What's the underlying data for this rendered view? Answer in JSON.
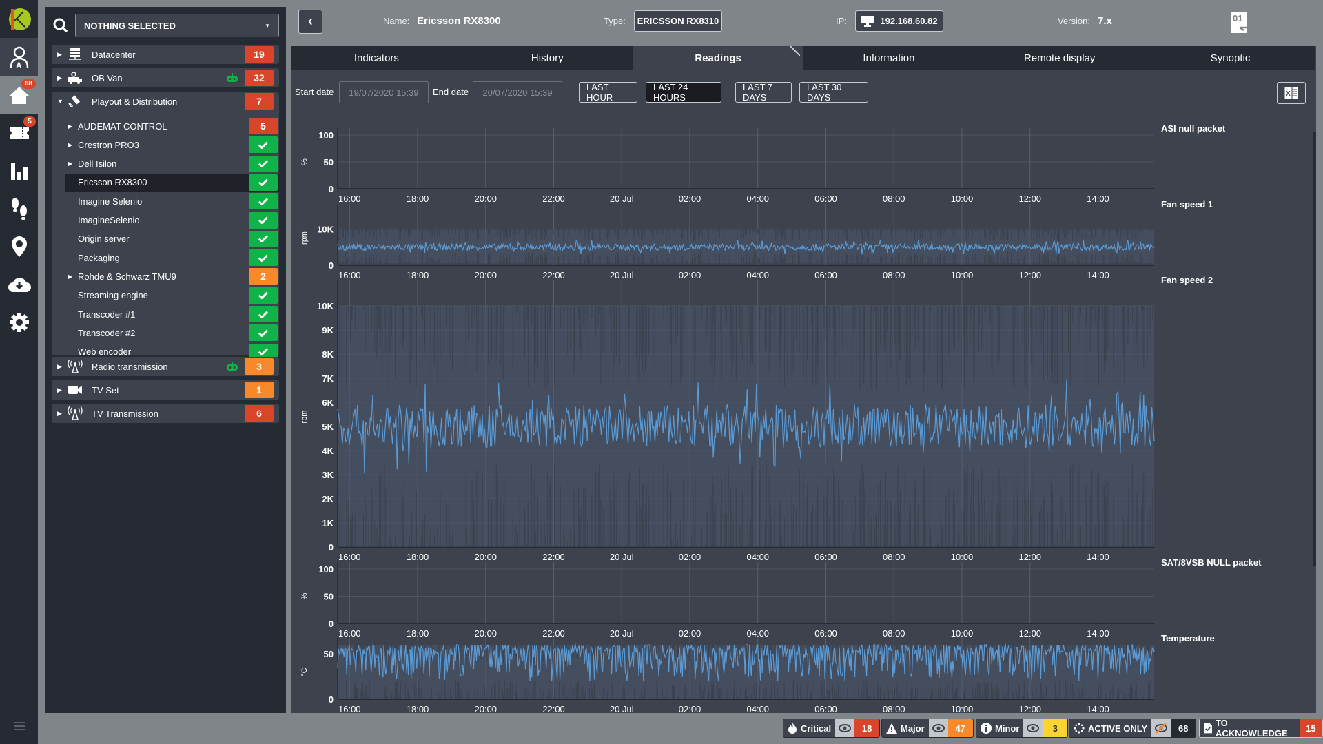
{
  "rail": {
    "items": [
      {
        "icon": "logo-icon"
      },
      {
        "icon": "user-admin-icon"
      },
      {
        "icon": "home-icon",
        "badge": "68"
      },
      {
        "icon": "ticket-icon",
        "badge": "5"
      },
      {
        "icon": "bar-chart-icon"
      },
      {
        "icon": "footsteps-icon"
      },
      {
        "icon": "map-pin-icon"
      },
      {
        "icon": "cloud-download-icon"
      },
      {
        "icon": "gear-icon"
      },
      {
        "icon": "menu-icon"
      }
    ]
  },
  "tree": {
    "search_value": "NOTHING SELECTED",
    "groups": [
      {
        "label": "Datacenter",
        "icon": "server-icon",
        "count": "19",
        "status": "red",
        "robot": false
      },
      {
        "label": "OB Van",
        "icon": "ob-van-icon",
        "count": "32",
        "status": "red",
        "robot": true
      },
      {
        "label": "Playout & Distribution",
        "icon": "satellite-icon",
        "count": "7",
        "status": "red",
        "robot": false,
        "expanded": true
      },
      {
        "label": "Radio transmission",
        "icon": "antenna-icon",
        "count": "3",
        "status": "orange",
        "robot": true
      },
      {
        "label": "TV Set",
        "icon": "video-camera-icon",
        "count": "1",
        "status": "orange",
        "robot": false
      },
      {
        "label": "TV Transmission",
        "icon": "antenna-icon",
        "count": "6",
        "status": "red",
        "robot": false
      }
    ],
    "children": [
      {
        "label": "AUDEMAT CONTROL",
        "expandable": true,
        "count": "5",
        "status": "red"
      },
      {
        "label": "Crestron PRO3",
        "expandable": true,
        "status": "ok"
      },
      {
        "label": "Dell Isilon",
        "expandable": true,
        "status": "ok"
      },
      {
        "label": "Ericsson RX8300",
        "expandable": false,
        "status": "ok",
        "selected": true
      },
      {
        "label": "Imagine Selenio",
        "expandable": false,
        "status": "ok"
      },
      {
        "label": "ImagineSelenio",
        "expandable": false,
        "status": "ok"
      },
      {
        "label": "Origin server",
        "expandable": false,
        "status": "ok"
      },
      {
        "label": "Packaging",
        "expandable": false,
        "status": "ok"
      },
      {
        "label": "Rohde & Schwarz TMU9",
        "expandable": true,
        "count": "2",
        "status": "orange"
      },
      {
        "label": "Streaming engine",
        "expandable": false,
        "status": "ok"
      },
      {
        "label": "Transcoder #1",
        "expandable": false,
        "status": "ok"
      },
      {
        "label": "Transcoder #2",
        "expandable": false,
        "status": "ok"
      },
      {
        "label": "Web encoder",
        "expandable": false,
        "status": "ok"
      }
    ]
  },
  "header": {
    "name_label": "Name:",
    "name_value": "Ericsson RX8300",
    "type_label": "Type:",
    "type_value": "ERICSSON RX8310",
    "ip_label": "IP:",
    "ip_value": "192.168.60.82",
    "version_label": "Version:",
    "version_value": "7.x"
  },
  "tabs": [
    {
      "label": "Indicators"
    },
    {
      "label": "History"
    },
    {
      "label": "Readings",
      "active": true
    },
    {
      "label": "Information"
    },
    {
      "label": "Remote display"
    },
    {
      "label": "Synoptic"
    }
  ],
  "filters": {
    "start_label": "Start date",
    "start_value": "19/07/2020 15:39",
    "end_label": "End date",
    "end_value": "20/07/2020 15:39",
    "ranges": [
      {
        "label": "LAST HOUR"
      },
      {
        "label": "LAST 24 HOURS",
        "active": true
      },
      {
        "label": "LAST 7 DAYS"
      },
      {
        "label": "LAST 30 DAYS"
      }
    ]
  },
  "chart_data": [
    {
      "type": "line",
      "title": "ASI null packet",
      "ylabel": "%",
      "ylim": [
        0,
        100
      ],
      "yticks": [
        "0",
        "50",
        "100"
      ],
      "xticks": [
        "16:00",
        "18:00",
        "20:00",
        "22:00",
        "20 Jul",
        "02:00",
        "04:00",
        "06:00",
        "08:00",
        "10:00",
        "12:00",
        "14:00"
      ],
      "series": [],
      "grid": true
    },
    {
      "type": "area",
      "title": "Fan speed 1",
      "ylabel": "rpm",
      "ylim": [
        0,
        15000
      ],
      "yticks": [
        "0",
        "10K"
      ],
      "yvals": [
        0,
        10000
      ],
      "xticks": [
        "16:00",
        "18:00",
        "20:00",
        "22:00",
        "20 Jul",
        "02:00",
        "04:00",
        "06:00",
        "08:00",
        "10:00",
        "12:00",
        "14:00"
      ],
      "series": [
        {
          "name": "Fan speed 1",
          "mean": 5000,
          "spread": 900,
          "band": [
            500,
            9800
          ]
        }
      ],
      "grid": true
    },
    {
      "type": "area",
      "title": "Fan speed 2",
      "ylabel": "rpm",
      "ylim": [
        0,
        10800
      ],
      "yticks": [
        "0",
        "1K",
        "2K",
        "3K",
        "4K",
        "5K",
        "6K",
        "7K",
        "8K",
        "9K",
        "10K"
      ],
      "yvals": [
        0,
        1000,
        2000,
        3000,
        4000,
        5000,
        6000,
        7000,
        8000,
        9000,
        10000
      ],
      "xticks": [
        "16:00",
        "18:00",
        "20:00",
        "22:00",
        "20 Jul",
        "02:00",
        "04:00",
        "06:00",
        "08:00",
        "10:00",
        "12:00",
        "14:00"
      ],
      "series": [
        {
          "name": "Fan speed 2",
          "mean": 5000,
          "spread": 900,
          "band": [
            0,
            10000
          ]
        }
      ],
      "grid": true
    },
    {
      "type": "line",
      "title": "SAT/8VSB NULL packet",
      "ylabel": "%",
      "ylim": [
        0,
        100
      ],
      "yticks": [
        "0",
        "50",
        "100"
      ],
      "xticks": [
        "16:00",
        "18:00",
        "20:00",
        "22:00",
        "20 Jul",
        "02:00",
        "04:00",
        "06:00",
        "08:00",
        "10:00",
        "12:00",
        "14:00"
      ],
      "series": [],
      "grid": true
    },
    {
      "type": "area",
      "title": "Temperature",
      "ylabel": "°C",
      "ylim": [
        0,
        60
      ],
      "yticks": [
        "0",
        "50"
      ],
      "yvals": [
        0,
        50
      ],
      "xticks": [
        "16:00",
        "18:00",
        "20:00",
        "22:00",
        "20 Jul",
        "02:00",
        "04:00",
        "06:00",
        "08:00",
        "10:00",
        "12:00",
        "14:00"
      ],
      "series": [
        {
          "name": "Temperature",
          "mean": 48,
          "spread": 10,
          "band": [
            0,
            60
          ]
        }
      ],
      "grid": true
    }
  ],
  "footer": {
    "critical": {
      "label": "Critical",
      "count": "18"
    },
    "major": {
      "label": "Major",
      "count": "47"
    },
    "minor": {
      "label": "Minor",
      "count": "3"
    },
    "active": {
      "label": "ACTIVE ONLY",
      "count": "68"
    },
    "ack": {
      "label": "TO ACKNOWLEDGE",
      "count": "15"
    }
  },
  "colors": {
    "critical": "#d9452b",
    "major": "#f7892a",
    "minor": "#fcd432",
    "ok": "#10b347",
    "series": "#5b9bd5"
  }
}
